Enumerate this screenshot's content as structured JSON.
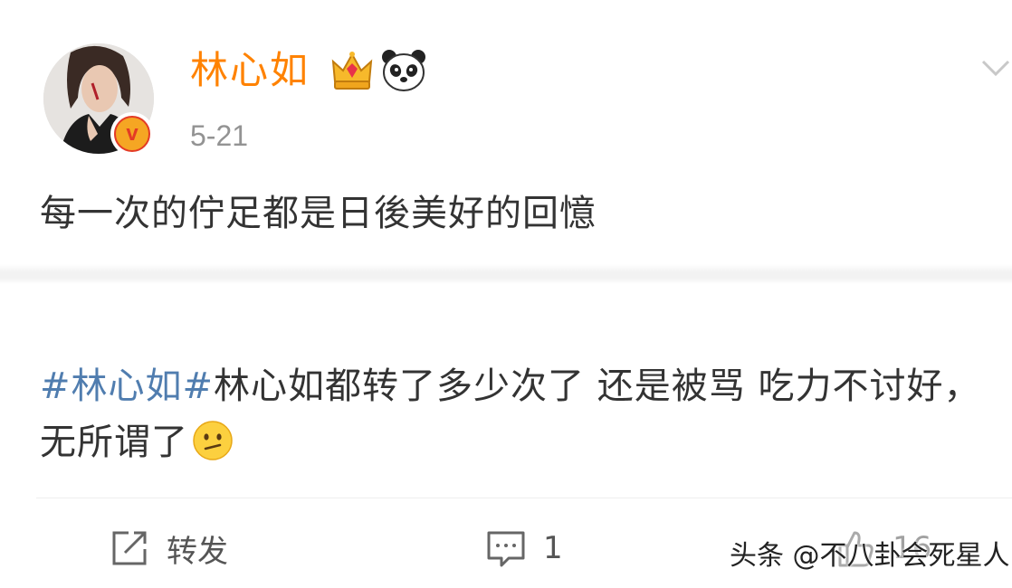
{
  "post": {
    "author": {
      "name": "林心如",
      "badges": [
        "crown-icon",
        "panda-icon"
      ],
      "verified": true
    },
    "date": "5-21",
    "original_text": "每一次的佇足都是日後美好的回憶"
  },
  "repost": {
    "hashtag": "#林心如#",
    "text": "林心如都转了多少次了 还是被骂 吃力不讨好，无所谓了",
    "emoji": "confused-face-icon"
  },
  "actions": {
    "repost_label": "转发",
    "comment_count": "1",
    "like_count": "16"
  },
  "watermark": "头条 @不八卦会死星人",
  "colors": {
    "username": "#ff8200",
    "hashtag": "#507daf",
    "date": "#939393",
    "text": "#333333"
  }
}
